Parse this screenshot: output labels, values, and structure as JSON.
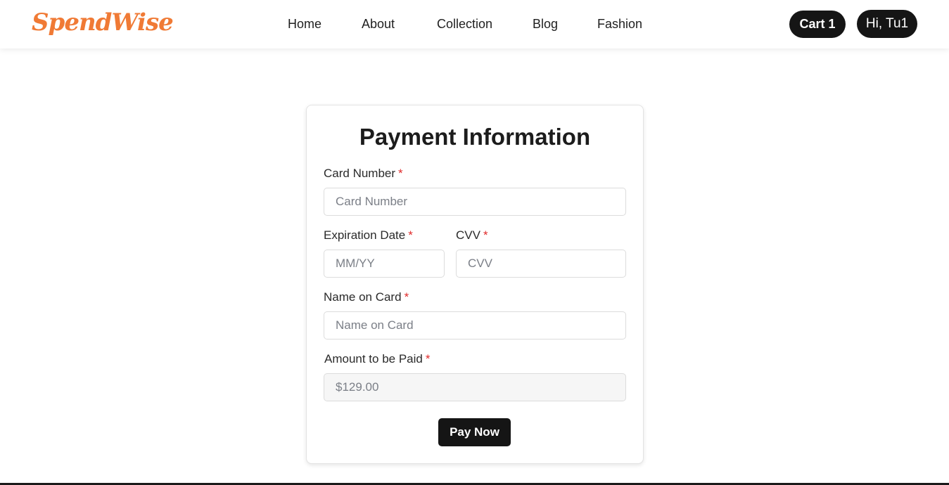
{
  "brand": {
    "name": "SpendWise",
    "color": "#f07a35"
  },
  "nav": {
    "items": [
      {
        "label": "Home"
      },
      {
        "label": "About"
      },
      {
        "label": "Collection"
      },
      {
        "label": "Blog"
      },
      {
        "label": "Fashion"
      }
    ],
    "cart_label": "Cart 1",
    "user_label": "Hi, Tu1"
  },
  "form": {
    "title": "Payment Information",
    "required_mark": "*",
    "card_number": {
      "label": "Card Number",
      "placeholder": "Card Number",
      "value": ""
    },
    "expiration": {
      "label": "Expiration Date",
      "placeholder": "MM/YY",
      "value": ""
    },
    "cvv": {
      "label": "CVV",
      "placeholder": "CVV",
      "value": ""
    },
    "name_on_card": {
      "label": "Name on Card",
      "placeholder": "Name on Card",
      "value": ""
    },
    "amount": {
      "label": "Amount to be Paid",
      "value": "$129.00"
    },
    "submit_label": "Pay Now"
  },
  "colors": {
    "accent": "#f07a35",
    "dark": "#151515",
    "required": "#e02b2b"
  }
}
